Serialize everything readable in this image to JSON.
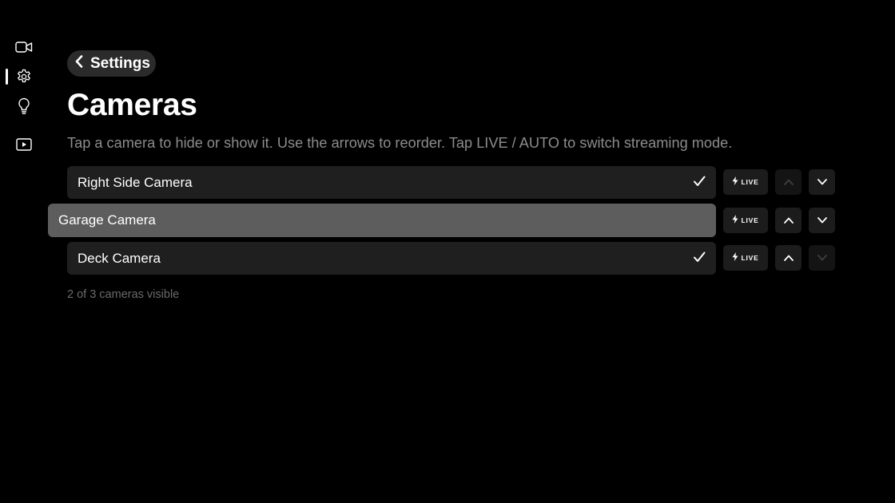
{
  "sidebar": {
    "items": [
      {
        "name": "video-camera-icon"
      },
      {
        "name": "gear-icon",
        "active": true
      },
      {
        "name": "lightbulb-icon"
      },
      {
        "name": "play-icon"
      }
    ]
  },
  "header": {
    "back_label": "Settings",
    "title": "Cameras",
    "subtitle": "Tap a camera to hide or show it. Use the arrows to reorder. Tap LIVE / AUTO to switch streaming mode."
  },
  "cameras": [
    {
      "name": "Right Side Camera",
      "visible": true,
      "mode": "LIVE",
      "can_move_up": false,
      "can_move_down": true,
      "focused": false
    },
    {
      "name": "Garage Camera",
      "visible": false,
      "mode": "LIVE",
      "can_move_up": true,
      "can_move_down": true,
      "focused": true
    },
    {
      "name": "Deck Camera",
      "visible": true,
      "mode": "LIVE",
      "can_move_up": true,
      "can_move_down": false,
      "focused": false
    }
  ],
  "footer": {
    "count_text": "2 of 3 cameras visible"
  },
  "colors": {
    "background": "#000000",
    "card": "#1f1f1f",
    "card_focused": "#5d5d5d",
    "muted_text": "#8c8c8c"
  }
}
